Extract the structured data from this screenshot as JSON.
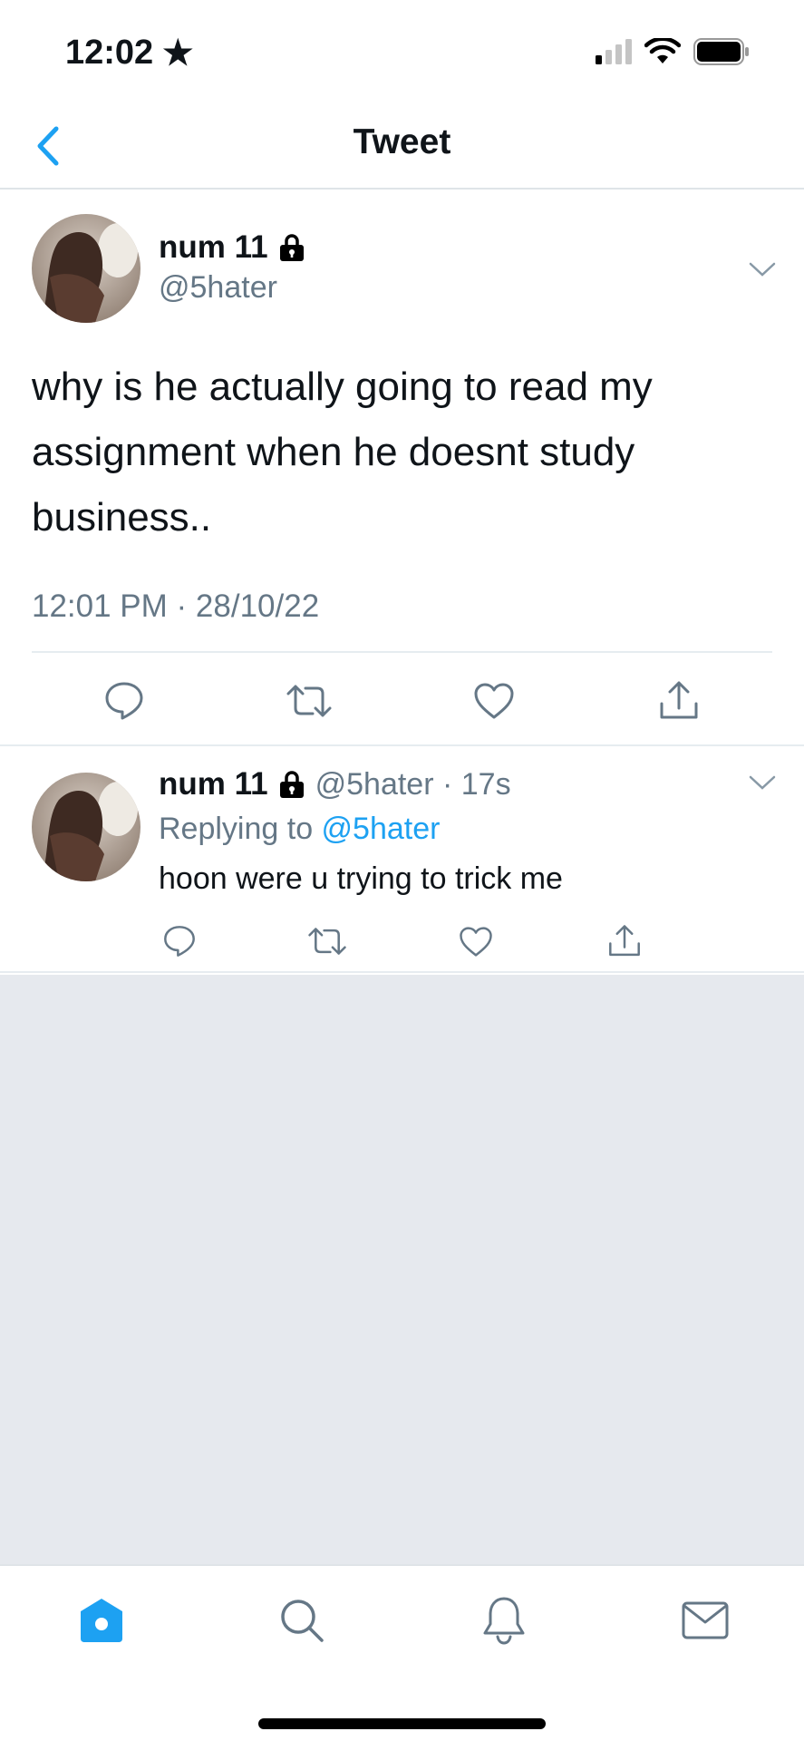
{
  "status_bar": {
    "time": "12:02",
    "location_glyph": "★",
    "icons": [
      "cellular-signal-icon",
      "wifi-icon",
      "battery-icon"
    ]
  },
  "nav": {
    "title": "Tweet",
    "back_icon": "chevron-left-icon"
  },
  "main_tweet": {
    "display_name": "num 11",
    "handle": "@5hater",
    "text": "why is he actually going to read my assignment when he doesnt study business..",
    "timestamp": "12:01 PM · 28/10/22",
    "actions": [
      "reply-icon",
      "retweet-icon",
      "like-icon",
      "share-icon"
    ]
  },
  "reply_tweet": {
    "display_name": "num 11",
    "handle_time": "@5hater · 17s",
    "replying_prefix": "Replying to ",
    "replying_to": "@5hater",
    "text": "hoon were u trying to trick me",
    "actions": [
      "reply-icon",
      "retweet-icon",
      "like-icon",
      "share-icon"
    ]
  },
  "tab_bar": {
    "tabs": [
      "home-icon",
      "search-icon",
      "notifications-icon",
      "messages-icon"
    ],
    "active_tab": "home"
  },
  "colors": {
    "accent": "#1da1f2",
    "secondary_text": "#657786",
    "empty_background": "#e6e9ee"
  }
}
